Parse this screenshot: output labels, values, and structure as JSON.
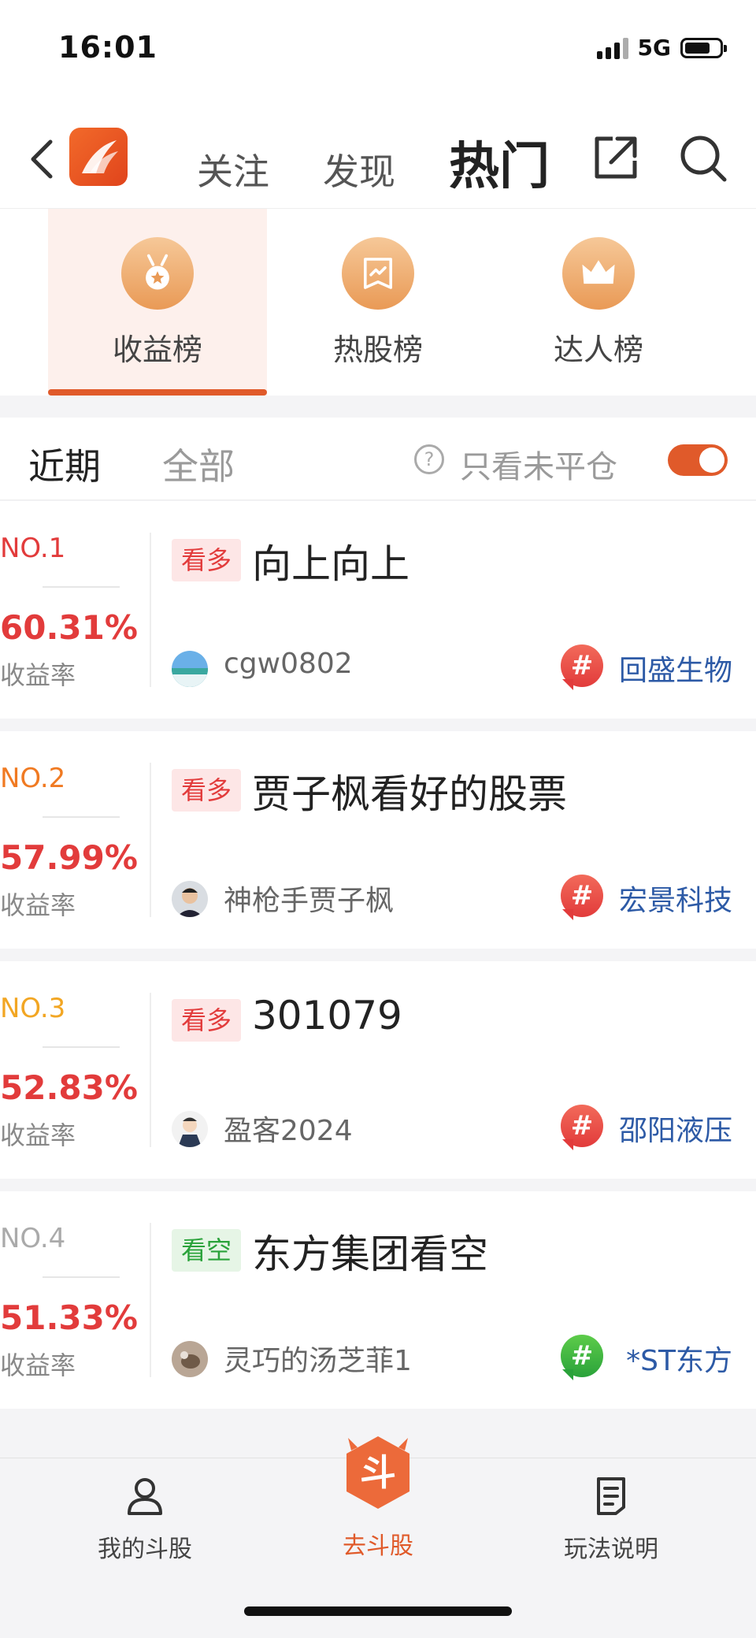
{
  "status": {
    "time": "16:01",
    "network": "5G",
    "battery_pct": 74
  },
  "nav": {
    "tabs": [
      "关注",
      "发现",
      "热门"
    ],
    "active": "热门"
  },
  "categories": [
    {
      "label": "收益榜",
      "icon": "medal-icon",
      "active": true
    },
    {
      "label": "热股榜",
      "icon": "trend-flag-icon",
      "active": false
    },
    {
      "label": "达人榜",
      "icon": "crown-icon",
      "active": false
    }
  ],
  "filter": {
    "tabs": [
      "近期",
      "全部"
    ],
    "active": "近期",
    "only_open_label": "只看未平仓",
    "only_open_on": true
  },
  "colors": {
    "accent": "#e05a2a",
    "up": "#e23b3b",
    "down": "#2aa23a",
    "link": "#2d5aa6"
  },
  "rows": [
    {
      "rank": "NO.1",
      "rank_color": "#e23b3b",
      "rate": "60.31%",
      "rate_label": "收益率",
      "tag": "看多",
      "tag_type": "bull",
      "title": "向上向上",
      "user": "cgw0802",
      "stock": "回盛生物",
      "hash_color": "red"
    },
    {
      "rank": "NO.2",
      "rank_color": "#f07a22",
      "rate": "57.99%",
      "rate_label": "收益率",
      "tag": "看多",
      "tag_type": "bull",
      "title": "贾子枫看好的股票",
      "user": "神枪手贾子枫",
      "stock": "宏景科技",
      "hash_color": "red"
    },
    {
      "rank": "NO.3",
      "rank_color": "#f2a623",
      "rate": "52.83%",
      "rate_label": "收益率",
      "tag": "看多",
      "tag_type": "bull",
      "title": "301079",
      "user": "盈客2024",
      "stock": "邵阳液压",
      "hash_color": "red"
    },
    {
      "rank": "NO.4",
      "rank_color": "#aaaaaa",
      "rate": "51.33%",
      "rate_label": "收益率",
      "tag": "看空",
      "tag_type": "bear",
      "title": "东方集团看空",
      "user": "灵巧的汤芝菲1",
      "stock": "*ST东方",
      "hash_color": "green"
    }
  ],
  "tabbar": [
    {
      "label": "我的斗股",
      "icon": "person-icon"
    },
    {
      "label": "去斗股",
      "icon": "dou-badge-icon",
      "center_glyph": "斗"
    },
    {
      "label": "玩法说明",
      "icon": "document-icon"
    }
  ]
}
